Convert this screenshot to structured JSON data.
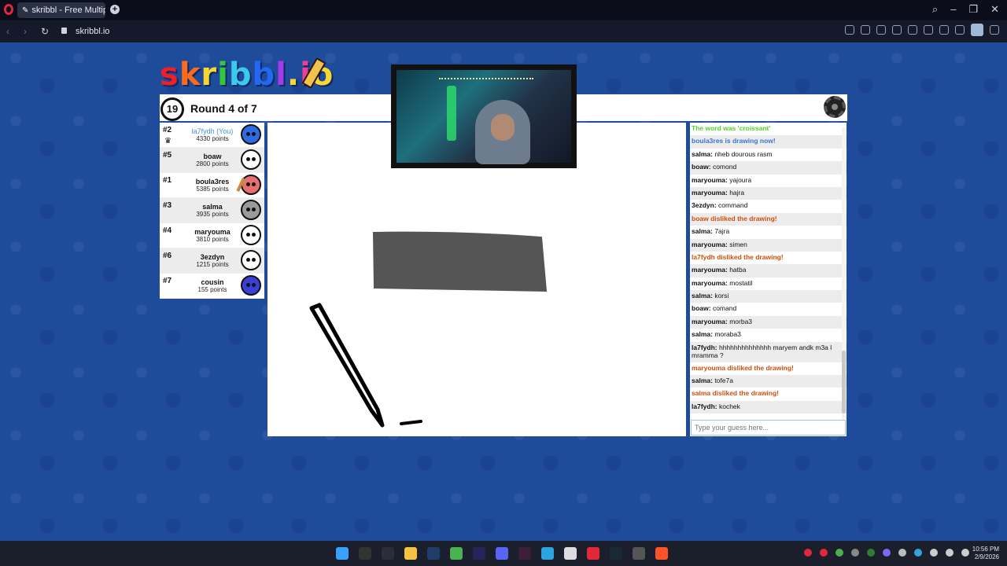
{
  "browser": {
    "tab_title": "skribbl - Free Multiplayer",
    "url": "skribbl.io"
  },
  "game": {
    "logo_letters": [
      "s",
      "k",
      "r",
      "i",
      "b",
      "b",
      "l",
      ".",
      "i",
      "o"
    ],
    "logo_colors": [
      "#ef1f2a",
      "#ff6b1c",
      "#f6d733",
      "#35c73c",
      "#3bc9ec",
      "#2467f0",
      "#a43ae8",
      "#f6d733",
      "#ef3d98",
      "#f6d733"
    ],
    "timer": "19",
    "round_text": "Round 4 of 7"
  },
  "players": [
    {
      "rank": "#2",
      "name": "la7fydh (You)",
      "points": "4330 points",
      "color": "#2f6be0",
      "you": true
    },
    {
      "rank": "#5",
      "name": "boaw",
      "points": "2800 points",
      "color": "#ffffff",
      "you": false
    },
    {
      "rank": "#1",
      "name": "boula3res",
      "points": "5385 points",
      "color": "#e86f6f",
      "you": false
    },
    {
      "rank": "#3",
      "name": "salma",
      "points": "3935 points",
      "color": "#9a9a9a",
      "you": false
    },
    {
      "rank": "#4",
      "name": "maryouma",
      "points": "3810 points",
      "color": "#ffffff",
      "you": false
    },
    {
      "rank": "#6",
      "name": "3ezdyn",
      "points": "1215 points",
      "color": "#ffffff",
      "you": false
    },
    {
      "rank": "#7",
      "name": "cousin",
      "points": "155 points",
      "color": "#3a3fd6",
      "you": false
    }
  ],
  "chat": [
    {
      "type": "green",
      "text": "The word was 'croissant'"
    },
    {
      "type": "blue",
      "text": "boula3res is drawing now!"
    },
    {
      "type": "msg",
      "user": "salma:",
      "text": "nheb dourous rasm"
    },
    {
      "type": "msg",
      "user": "boaw:",
      "text": "comond"
    },
    {
      "type": "msg",
      "user": "maryouma:",
      "text": "yajoura"
    },
    {
      "type": "msg",
      "user": "maryouma:",
      "text": "hajra"
    },
    {
      "type": "msg",
      "user": "3ezdyn:",
      "text": "command"
    },
    {
      "type": "orange",
      "text": "boaw disliked the drawing!"
    },
    {
      "type": "msg",
      "user": "salma:",
      "text": "7ajra"
    },
    {
      "type": "msg",
      "user": "maryouma:",
      "text": "simen"
    },
    {
      "type": "orange",
      "text": "la7fydh disliked the drawing!"
    },
    {
      "type": "msg",
      "user": "maryouma:",
      "text": "hatba"
    },
    {
      "type": "msg",
      "user": "maryouma:",
      "text": "mostatil"
    },
    {
      "type": "msg",
      "user": "salma:",
      "text": "korsi"
    },
    {
      "type": "msg",
      "user": "boaw:",
      "text": "comand"
    },
    {
      "type": "msg",
      "user": "maryouma:",
      "text": "morba3"
    },
    {
      "type": "msg",
      "user": "salma:",
      "text": "moraba3"
    },
    {
      "type": "msg",
      "user": "la7fydh:",
      "text": "hhhhhhhhhhhhhh maryem andk m3a l mramma ?"
    },
    {
      "type": "orange",
      "text": "maryouma disliked the drawing!"
    },
    {
      "type": "msg",
      "user": "salma:",
      "text": "tofe7a"
    },
    {
      "type": "orange",
      "text": "salma disliked the drawing!"
    },
    {
      "type": "msg",
      "user": "la7fydh:",
      "text": "kochek"
    }
  ],
  "guess_placeholder": "Type your guess here...",
  "taskbar": {
    "time": "10:56 PM",
    "date": "2/9/2026"
  }
}
